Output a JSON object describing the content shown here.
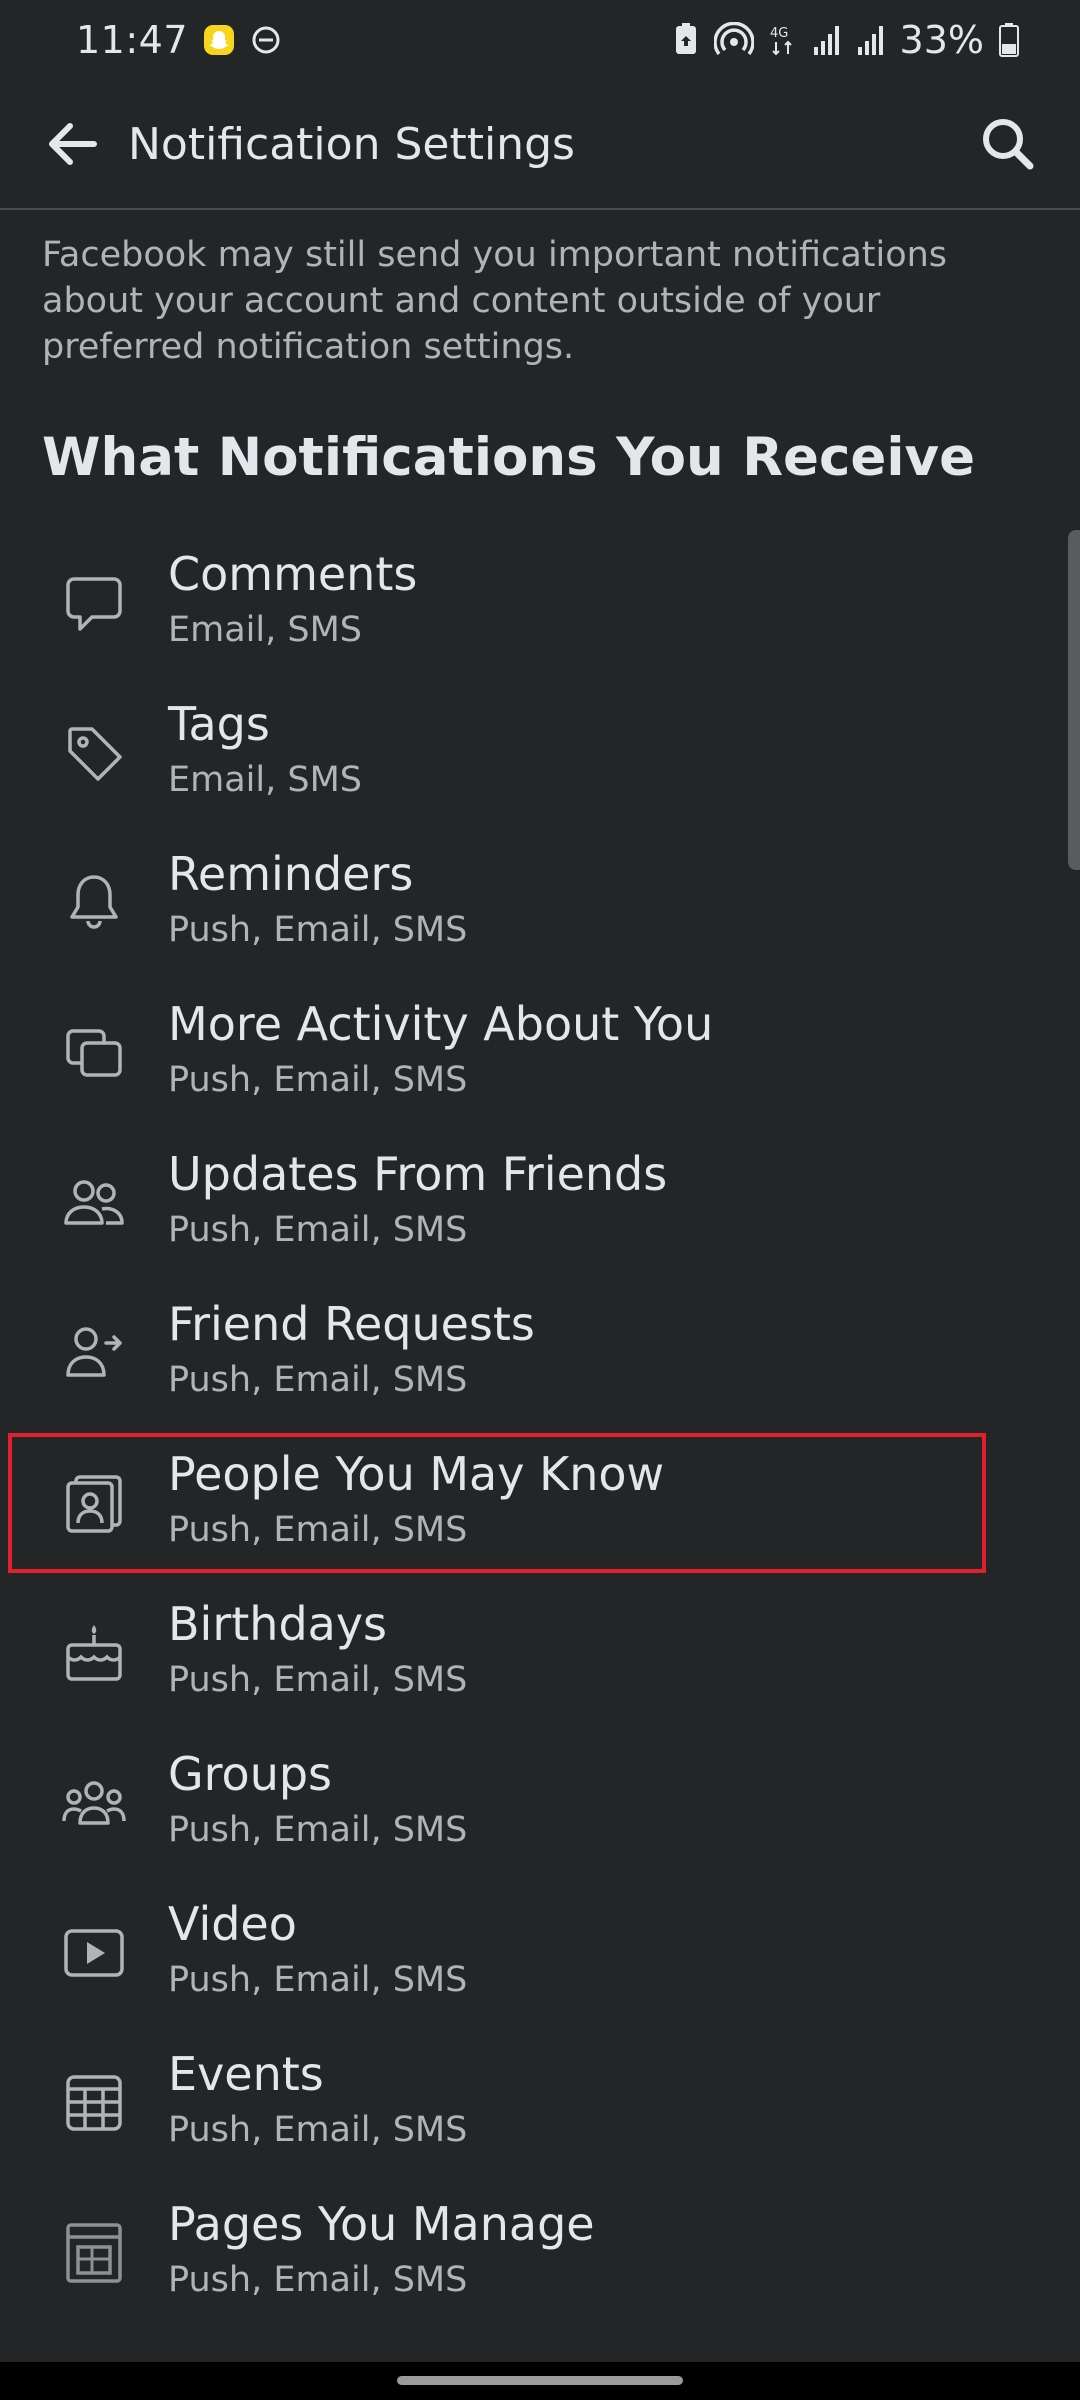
{
  "status_bar": {
    "time": "11:47",
    "battery": "33%",
    "network": "4G"
  },
  "app_bar": {
    "title": "Notification Settings"
  },
  "info_text": "Facebook may still send you important notifications about your account and content outside of your preferred notification settings.",
  "section_heading": "What Notifications You Receive",
  "items": [
    {
      "title": "Comments",
      "subtitle": "Email, SMS",
      "icon": "comment-icon"
    },
    {
      "title": "Tags",
      "subtitle": "Email, SMS",
      "icon": "tag-icon"
    },
    {
      "title": "Reminders",
      "subtitle": "Push, Email, SMS",
      "icon": "bell-icon"
    },
    {
      "title": "More Activity About You",
      "subtitle": "Push, Email, SMS",
      "icon": "activity-icon"
    },
    {
      "title": "Updates From Friends",
      "subtitle": "Push, Email, SMS",
      "icon": "friends-icon"
    },
    {
      "title": "Friend Requests",
      "subtitle": "Push, Email, SMS",
      "icon": "friend-request-icon"
    },
    {
      "title": "People You May Know",
      "subtitle": "Push, Email, SMS",
      "icon": "people-you-may-know-icon"
    },
    {
      "title": "Birthdays",
      "subtitle": "Push, Email, SMS",
      "icon": "birthday-cake-icon"
    },
    {
      "title": "Groups",
      "subtitle": "Push, Email, SMS",
      "icon": "groups-icon"
    },
    {
      "title": "Video",
      "subtitle": "Push, Email, SMS",
      "icon": "video-icon"
    },
    {
      "title": "Events",
      "subtitle": "Push, Email, SMS",
      "icon": "calendar-icon"
    },
    {
      "title": "Pages You Manage",
      "subtitle": "Push, Email, SMS",
      "icon": "page-icon"
    }
  ],
  "highlight_color": "#e0202a",
  "background_color": "#242526"
}
